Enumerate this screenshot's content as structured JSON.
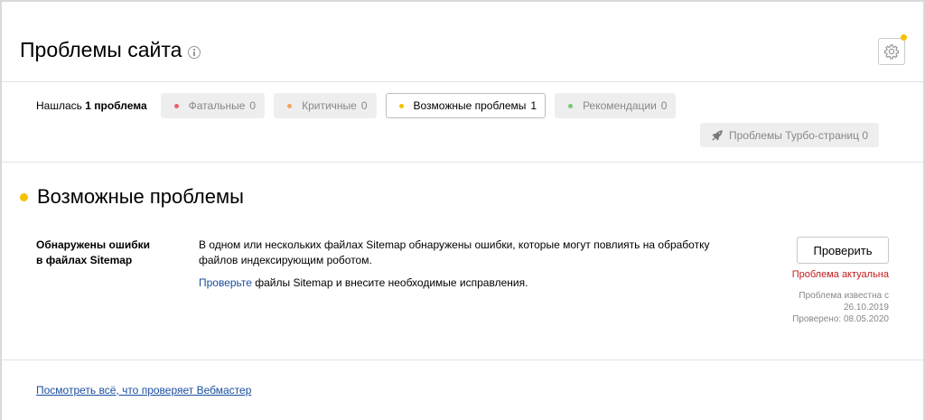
{
  "header": {
    "title": "Проблемы сайта",
    "info_icon": "info-icon",
    "settings_icon": "gear-icon",
    "accent_dot_color": "#f6c100"
  },
  "filters": {
    "found_prefix": "Нашлась ",
    "found_count_text": "1 проблема",
    "chips": [
      {
        "label": "Фатальные",
        "count": "0",
        "dot_color": "#e8636a",
        "active": false
      },
      {
        "label": "Критичные",
        "count": "0",
        "dot_color": "#f5a55c",
        "active": false
      },
      {
        "label": "Возможные проблемы",
        "count": "1",
        "dot_color": "#f6c100",
        "active": true
      },
      {
        "label": "Рекомендации",
        "count": "0",
        "dot_color": "#78c97b",
        "active": false
      }
    ],
    "turbo": {
      "label": "Проблемы Турбо-страниц",
      "count": "0",
      "icon": "rocket-icon"
    }
  },
  "section": {
    "title": "Возможные проблемы",
    "dot_color": "#f6c100"
  },
  "issue": {
    "name_line1": "Обнаружены ошибки",
    "name_line2": "в файлах Sitemap",
    "description": "В одном или нескольких файлах Sitemap обнаружены ошибки, которые могут повлиять на обработку файлов индексирующим роботом.",
    "action_link": "Проверьте",
    "action_rest": " файлы Sitemap и внесите необходимые исправления.",
    "check_button": "Проверить",
    "status": "Проблема актуальна",
    "known_since_label": "Проблема известна с",
    "known_since_date": "26.10.2019",
    "checked": "Проверено: 08.05.2020"
  },
  "footer": {
    "link": "Посмотреть всё, что проверяет Вебмастер"
  }
}
